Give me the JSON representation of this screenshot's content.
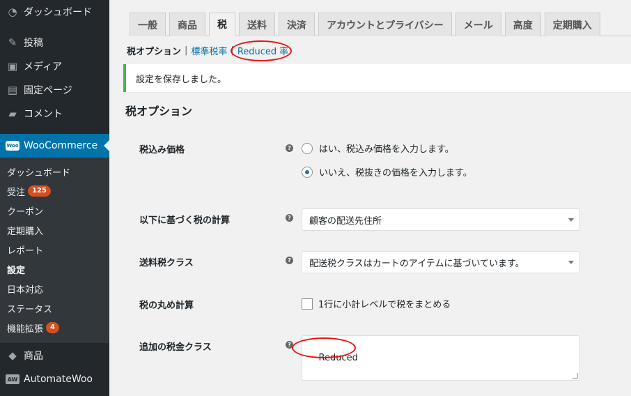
{
  "sidebar": {
    "top_items": [
      {
        "label": "ダッシュボード",
        "icon": "dashboard-icon"
      },
      {
        "label": "投稿",
        "icon": "pin-icon"
      },
      {
        "label": "メディア",
        "icon": "media-icon"
      },
      {
        "label": "固定ページ",
        "icon": "page-icon"
      },
      {
        "label": "コメント",
        "icon": "comment-icon"
      }
    ],
    "woo": {
      "label": "WooCommerce",
      "logo_text": "Woo"
    },
    "sub_items": [
      {
        "label": "ダッシュボード"
      },
      {
        "label": "受注",
        "badge": "125"
      },
      {
        "label": "クーポン"
      },
      {
        "label": "定期購入"
      },
      {
        "label": "レポート"
      },
      {
        "label": "設定"
      },
      {
        "label": "日本対応"
      },
      {
        "label": "ステータス"
      },
      {
        "label": "機能拡張",
        "badge": "4"
      }
    ],
    "bottom_items": [
      {
        "label": "商品",
        "icon": "product-icon"
      },
      {
        "label": "AutomateWoo",
        "logo_text": "AW"
      }
    ]
  },
  "tabs": [
    "一般",
    "商品",
    "税",
    "送料",
    "決済",
    "アカウントとプライバシー",
    "メール",
    "高度",
    "定期購入"
  ],
  "active_tab": "税",
  "subsub": {
    "current": "税オプション",
    "link1": "標準税率",
    "link2": "Reduced 率"
  },
  "notice": "設定を保存しました。",
  "section_title": "税オプション",
  "fields": {
    "prices_label": "税込み価格",
    "radio_yes": "はい、税込み価格を入力します。",
    "radio_no": "いいえ、税抜きの価格を入力します。",
    "based_on_label": "以下に基づく税の計算",
    "based_on_value": "顧客の配送先住所",
    "shipping_class_label": "送料税クラス",
    "shipping_class_value": "配送税クラスはカートのアイテムに基づいています。",
    "rounding_label": "税の丸め計算",
    "rounding_text": "1行に小計レベルで税をまとめる",
    "additional_label": "追加の税金クラス",
    "additional_value": "Reduced"
  },
  "help_glyph": "?",
  "colors": {
    "sidebar": "#23282d",
    "accent": "#0073aa",
    "notice_border": "#46b450",
    "annotation": "#e11111"
  }
}
